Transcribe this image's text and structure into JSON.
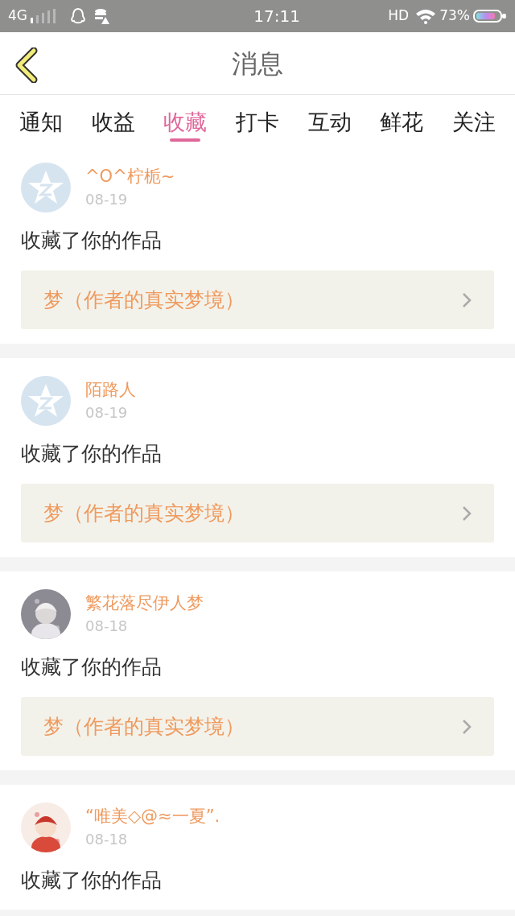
{
  "status_bar": {
    "network": "4G",
    "time": "17:11",
    "hd": "HD",
    "battery": "73%"
  },
  "header": {
    "title": "消息"
  },
  "tabs": [
    {
      "label": "通知",
      "selected": false
    },
    {
      "label": "收益",
      "selected": false
    },
    {
      "label": "收藏",
      "selected": true
    },
    {
      "label": "打卡",
      "selected": false
    },
    {
      "label": "互动",
      "selected": false
    },
    {
      "label": "鲜花",
      "selected": false
    },
    {
      "label": "关注",
      "selected": false
    }
  ],
  "messages": [
    {
      "avatar": {
        "kind": "default"
      },
      "name": "^O^柠栀~",
      "date": "08-19",
      "text": "收藏了你的作品",
      "work": "梦（作者的真实梦境）"
    },
    {
      "avatar": {
        "kind": "default"
      },
      "name": "陌路人",
      "date": "08-19",
      "text": "收藏了你的作品",
      "work": "梦（作者的真实梦境）"
    },
    {
      "name": "繁花落尽伊人梦",
      "date": "08-18",
      "text": "收藏了你的作品",
      "work": "梦（作者的真实梦境）"
    },
    {
      "name": "“唯美◇@≈一夏”.",
      "date": "08-18",
      "text": "收藏了你的作品"
    }
  ]
}
